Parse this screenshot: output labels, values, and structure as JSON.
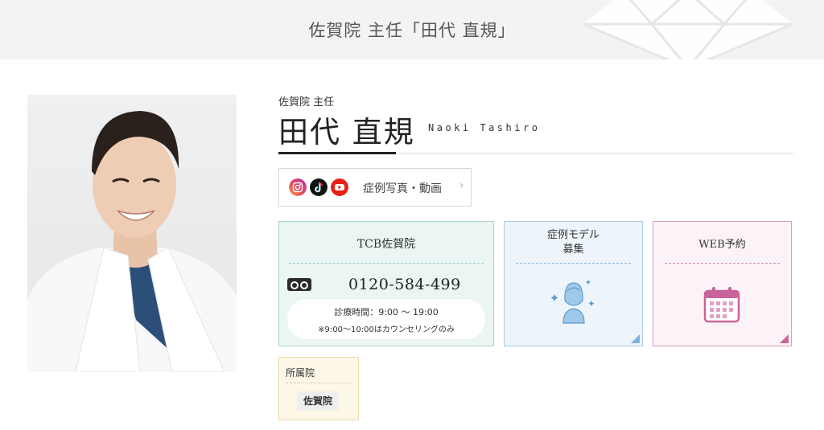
{
  "header": {
    "page_title": "佐賀院 主任「田代 直規」"
  },
  "profile": {
    "role": "佐賀院 主任",
    "name": "田代 直規",
    "name_roman": "Naoki Tashiro"
  },
  "sns": {
    "icons": [
      "instagram-icon",
      "tiktok-icon",
      "youtube-icon"
    ],
    "label": "症例写真・動画"
  },
  "clinic_card": {
    "title": "TCB佐賀院",
    "phone": "0120-584-499",
    "hours": "診療時間：9:00 〜 19:00",
    "note": "※9:00〜10:00はカウンセリングのみ"
  },
  "model_card": {
    "title_line1": "症例モデル",
    "title_line2": "募集"
  },
  "web_card": {
    "title": "WEB予約"
  },
  "affiliation": {
    "label": "所属院",
    "clinic": "佐賀院"
  },
  "colors": {
    "clinic_bg": "#eaf5f4",
    "model_bg": "#eef5fa",
    "web_bg": "#fbf3f7",
    "affil_bg": "#fdf7e7",
    "web_accent": "#c9649a",
    "model_accent": "#7fb0d8"
  }
}
